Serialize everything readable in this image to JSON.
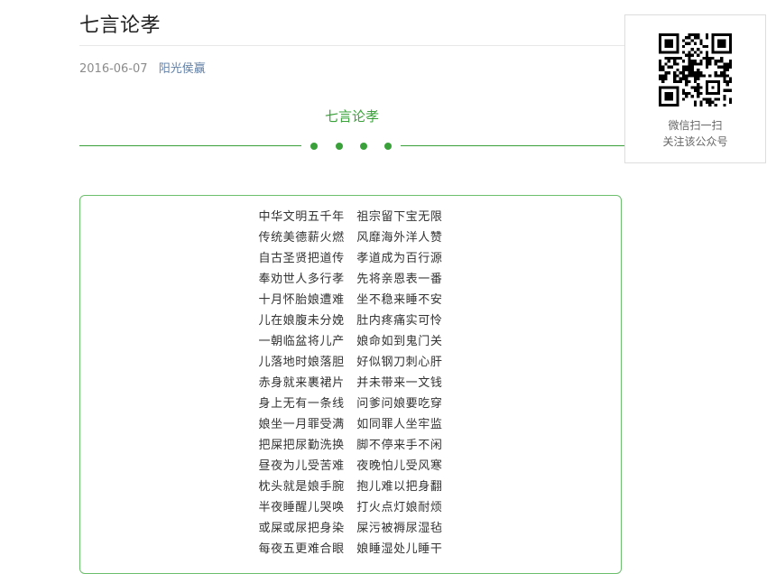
{
  "article": {
    "title": "七言论孝",
    "date": "2016-06-07",
    "author": "阳光侯赢",
    "section_heading": "七言论孝"
  },
  "poem": {
    "lines": [
      "中华文明五千年　祖宗留下宝无限",
      "传统美德薪火燃　风靡海外洋人赞",
      "自古圣贤把道传　孝道成为百行源",
      "奉劝世人多行孝　先将亲恩表一番",
      "十月怀胎娘遭难　坐不稳来睡不安",
      "儿在娘腹未分娩　肚内疼痛实可怜",
      "一朝临盆将儿产　娘命如到鬼门关",
      "儿落地时娘落胆　好似钢刀刺心肝",
      "赤身就来裹裙片　并未带来一文钱",
      "身上无有一条线　问爹问娘要吃穿",
      "娘坐一月罪受满　如同罪人坐牢监",
      "把屎把尿勤洗换　脚不停来手不闲",
      "昼夜为儿受苦难　夜晚怕儿受风寒",
      "枕头就是娘手腕　抱儿难以把身翻",
      "半夜睡醒儿哭唤　打火点灯娘耐烦",
      "或屎或尿把身染　屎污被褥尿湿毡",
      "每夜五更难合眼　娘睡湿处儿睡干"
    ]
  },
  "qr_panel": {
    "icon": "qr-code-icon",
    "caption_line1": "微信扫一扫",
    "caption_line2": "关注该公众号"
  },
  "colors": {
    "accent_green": "#3aa13a",
    "box_border": "#6cbf6c",
    "author_link": "#607fa6",
    "meta_gray": "#8c8c8c"
  }
}
